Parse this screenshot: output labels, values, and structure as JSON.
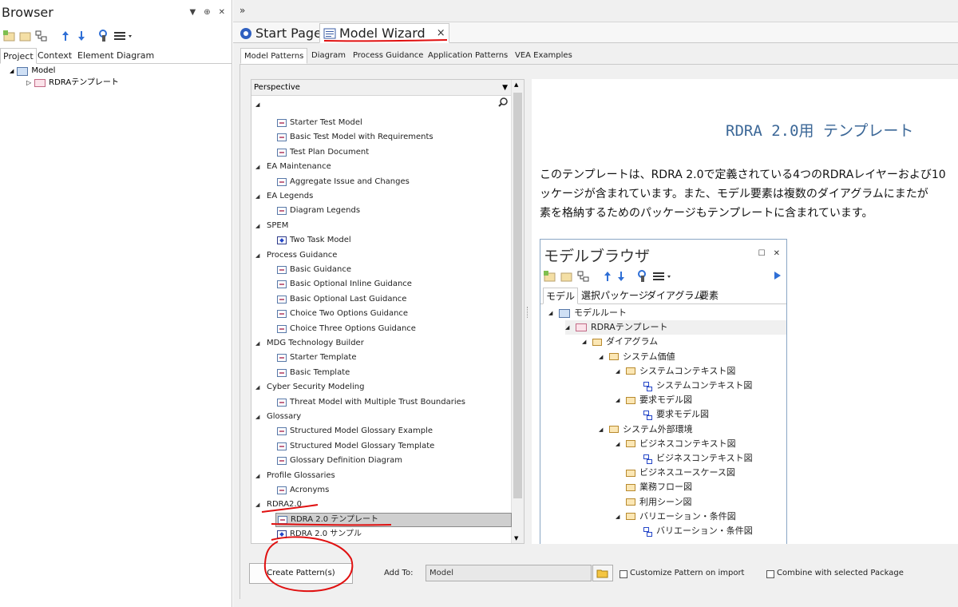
{
  "browser": {
    "title": "Browser",
    "tabs": [
      "Project",
      "Context",
      "Element",
      "Diagram"
    ],
    "tree": [
      {
        "label": "Model",
        "level": 0
      },
      {
        "label": "RDRAテンプレート",
        "level": 1
      }
    ]
  },
  "doc_tabs": {
    "start": "Start Page",
    "wizard": "Model Wizard",
    "close_glyph": "×"
  },
  "wizard_tabs": [
    "Model Patterns",
    "Diagram",
    "Process Guidance",
    "Application Patterns",
    "VEA Examples"
  ],
  "perspective": {
    "header": "Perspective",
    "rows": [
      {
        "type": "item",
        "icon": "model",
        "label": "Starter Test Model"
      },
      {
        "type": "item",
        "icon": "model",
        "label": "Basic Test Model with Requirements"
      },
      {
        "type": "item",
        "icon": "model",
        "label": "Test Plan Document"
      },
      {
        "type": "cat",
        "label": "EA Maintenance"
      },
      {
        "type": "item",
        "icon": "model",
        "label": "Aggregate Issue and Changes"
      },
      {
        "type": "cat",
        "label": "EA Legends"
      },
      {
        "type": "item",
        "icon": "model",
        "label": "Diagram Legends"
      },
      {
        "type": "cat",
        "label": "SPEM"
      },
      {
        "type": "item",
        "icon": "diagram",
        "label": "Two Task Model"
      },
      {
        "type": "cat",
        "label": "Process Guidance"
      },
      {
        "type": "item",
        "icon": "model",
        "label": "Basic Guidance"
      },
      {
        "type": "item",
        "icon": "model",
        "label": "Basic Optional Inline Guidance"
      },
      {
        "type": "item",
        "icon": "model",
        "label": "Basic Optional Last Guidance"
      },
      {
        "type": "item",
        "icon": "model",
        "label": "Choice Two Options Guidance"
      },
      {
        "type": "item",
        "icon": "model",
        "label": "Choice Three Options Guidance"
      },
      {
        "type": "cat",
        "label": "MDG Technology Builder"
      },
      {
        "type": "item",
        "icon": "model",
        "label": "Starter Template"
      },
      {
        "type": "item",
        "icon": "model",
        "label": "Basic Template"
      },
      {
        "type": "cat",
        "label": "Cyber Security Modeling"
      },
      {
        "type": "item",
        "icon": "model",
        "label": "Threat Model with Multiple Trust Boundaries"
      },
      {
        "type": "cat",
        "label": "Glossary"
      },
      {
        "type": "item",
        "icon": "model",
        "label": "Structured Model Glossary Example"
      },
      {
        "type": "item",
        "icon": "model",
        "label": "Structured Model Glossary Template"
      },
      {
        "type": "item",
        "icon": "model",
        "label": "Glossary Definition Diagram"
      },
      {
        "type": "cat",
        "label": "Profile Glossaries"
      },
      {
        "type": "item",
        "icon": "model",
        "label": "Acronyms"
      },
      {
        "type": "cat",
        "label": "RDRA2.0"
      },
      {
        "type": "item",
        "icon": "model",
        "label": "RDRA 2.0 テンプレート",
        "selected": true
      },
      {
        "type": "item",
        "icon": "diagram",
        "label": "RDRA 2.0 サンプル"
      }
    ]
  },
  "preview": {
    "title": "RDRA 2.0用 テンプレート",
    "lines": [
      "このテンプレートは、RDRA 2.0で定義されている4つのRDRAレイヤーおよび10",
      "ッケージが含まれています。また、モデル要素は複数のダイアグラムにまたが",
      "素を格納するためのパッケージもテンプレートに含まれています。"
    ],
    "mini": {
      "title": "モデルブラウザ",
      "tabs": [
        "モデル",
        "選択パッケージ",
        "ダイアグラム",
        "要素"
      ],
      "tree": [
        {
          "label": "モデルルート",
          "icon": "model"
        },
        {
          "label": "RDRAテンプレート",
          "icon": "template"
        },
        {
          "label": "ダイアグラム",
          "icon": "folder"
        },
        {
          "label": "システム価値",
          "icon": "folder"
        },
        {
          "label": "システムコンテキスト図",
          "icon": "folder"
        },
        {
          "label": "システムコンテキスト図",
          "icon": "diagram"
        },
        {
          "label": "要求モデル図",
          "icon": "folder"
        },
        {
          "label": "要求モデル図",
          "icon": "diagram"
        },
        {
          "label": "システム外部環境",
          "icon": "folder"
        },
        {
          "label": "ビジネスコンテキスト図",
          "icon": "folder"
        },
        {
          "label": "ビジネスコンテキスト図",
          "icon": "diagram"
        },
        {
          "label": "ビジネスユースケース図",
          "icon": "folder"
        },
        {
          "label": "業務フロー図",
          "icon": "folder"
        },
        {
          "label": "利用シーン図",
          "icon": "folder"
        },
        {
          "label": "バリエーション・条件図",
          "icon": "folder"
        },
        {
          "label": "バリエーション・条件図",
          "icon": "diagram"
        }
      ]
    }
  },
  "bottom": {
    "create_button": "Create Pattern(s)",
    "add_to_label": "Add To:",
    "add_to_value": "Model",
    "customize_label": "Customize Pattern on import",
    "combine_label": "Combine with selected Package"
  },
  "colors": {
    "accent_title": "#3b6797",
    "annotation_red": "#e01010"
  }
}
